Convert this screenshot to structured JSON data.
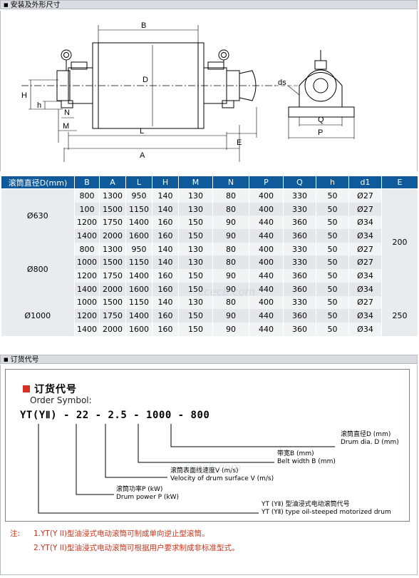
{
  "sections": {
    "install_title": "安装及外形尺寸",
    "order_title": "订货代号"
  },
  "drawing": {
    "labels": {
      "B": "B",
      "D": "D",
      "H": "H",
      "h": "h",
      "N": "N",
      "M": "M",
      "L": "L",
      "A": "A",
      "E": "E",
      "ds": "ds",
      "Q": "Q",
      "P": "P"
    }
  },
  "table": {
    "headers": [
      "滚筒直径D(mm)",
      "B",
      "A",
      "L",
      "H",
      "M",
      "N",
      "P",
      "Q",
      "h",
      "d1",
      "E"
    ],
    "groups": [
      {
        "diameter": "Ø630",
        "rows": [
          [
            "800",
            "1300",
            "950",
            "140",
            "130",
            "80",
            "400",
            "330",
            "50",
            "Ø27"
          ],
          [
            "100",
            "1500",
            "1150",
            "140",
            "130",
            "80",
            "400",
            "330",
            "50",
            "Ø27"
          ],
          [
            "1200",
            "1750",
            "1400",
            "160",
            "150",
            "90",
            "440",
            "360",
            "50",
            "Ø34"
          ],
          [
            "1400",
            "2000",
            "1600",
            "160",
            "150",
            "90",
            "440",
            "360",
            "50",
            "Ø34"
          ]
        ]
      },
      {
        "diameter": "Ø800",
        "rows": [
          [
            "800",
            "1300",
            "950",
            "140",
            "130",
            "80",
            "400",
            "330",
            "50",
            "Ø27"
          ],
          [
            "1000",
            "1500",
            "1150",
            "140",
            "130",
            "80",
            "400",
            "330",
            "50",
            "Ø27"
          ],
          [
            "1200",
            "1750",
            "1400",
            "160",
            "150",
            "90",
            "440",
            "360",
            "50",
            "Ø34"
          ],
          [
            "1400",
            "2000",
            "1600",
            "160",
            "150",
            "90",
            "440",
            "360",
            "50",
            "Ø34"
          ]
        ]
      },
      {
        "diameter": "Ø1000",
        "rows": [
          [
            "1000",
            "1500",
            "1150",
            "140",
            "130",
            "80",
            "400",
            "330",
            "50",
            "Ø27"
          ],
          [
            "1200",
            "1750",
            "1400",
            "160",
            "150",
            "90",
            "440",
            "360",
            "50",
            "Ø34"
          ],
          [
            "1400",
            "2000",
            "1600",
            "160",
            "150",
            "90",
            "440",
            "360",
            "50",
            "Ø34"
          ]
        ]
      }
    ],
    "e_values": [
      "200",
      "250"
    ]
  },
  "order": {
    "title": "订货代号",
    "subtitle": "Order Symbol:",
    "code": "YT(YⅡ) - 22 - 2.5 - 1000 - 800",
    "labels": [
      {
        "cn": "滚筒直径D (mm)",
        "en": "Drum dia. D (mm)"
      },
      {
        "cn": "带宽B (mm)",
        "en": "Belt width B (mm)"
      },
      {
        "cn": "滚筒表面线速度V (m/s)",
        "en": "Velocity of drum surface V (m/s)"
      },
      {
        "cn": "滚筒功率P (kW)",
        "en": "Drum power P (kW)"
      },
      {
        "cn": "YT (YⅡ) 型油浸式电动滚筒代号",
        "en": "YT (YⅡ) type oil-steeped motorized drum"
      }
    ]
  },
  "notes": {
    "prefix": "注:",
    "items": [
      "1.YT(Y II)型油浸式电动滚筒可制成单向逆止型滚筒。",
      "2.YT(Y II)型油浸式电动滚筒可根据用户要求制成非标准型式。"
    ]
  },
  "watermark": "ccecb.com",
  "colors": {
    "header_bg": "#0f5a9a",
    "accent_red": "#d62f24",
    "note_red": "#c8361e"
  }
}
